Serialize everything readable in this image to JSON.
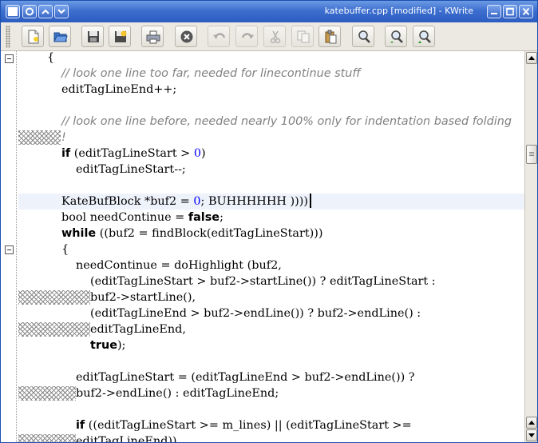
{
  "window": {
    "title": "katebuffer.cpp [modified] - KWrite",
    "minimize_glyph": "–",
    "close_glyph": "✕"
  },
  "toolbar": {
    "buttons": [
      {
        "name": "new-document-button",
        "icon": "new-document-icon"
      },
      {
        "name": "open-button",
        "icon": "folder-open-icon"
      },
      {
        "name": "save-button",
        "icon": "floppy-disk-icon"
      },
      {
        "name": "save-as-button",
        "icon": "save-as-icon"
      },
      {
        "name": "print-button",
        "icon": "printer-icon"
      },
      {
        "name": "close-document-button",
        "icon": "close-circle-icon"
      },
      {
        "name": "undo-button",
        "icon": "undo-icon"
      },
      {
        "name": "redo-button",
        "icon": "redo-icon"
      },
      {
        "name": "cut-button",
        "icon": "scissors-icon"
      },
      {
        "name": "copy-button",
        "icon": "copy-icon"
      },
      {
        "name": "paste-button",
        "icon": "clipboard-icon"
      },
      {
        "name": "find-button",
        "icon": "magnifier-icon"
      },
      {
        "name": "find-next-button",
        "icon": "magnifier-next-icon"
      },
      {
        "name": "find-previous-button",
        "icon": "magnifier-previous-icon"
      }
    ]
  },
  "editor": {
    "lines": [
      {
        "t": "{"
      },
      {
        "t": "// look one line too far, needed for linecontinue stuff"
      },
      {
        "t": "editTagLineEnd++;"
      },
      {
        "t": ""
      },
      {
        "t": "// look one line before, needed nearly 100% only for indentation based folding"
      },
      {
        "t": "!"
      },
      {
        "a": "if",
        "b": " (editTagLineStart > ",
        "c": "0",
        "d": ")"
      },
      {
        "t": "editTagLineStart--;"
      },
      {
        "t": ""
      },
      {
        "a": "KateBufBlock *buf2 = ",
        "b": "0",
        "c": "; BUHHHHHH ))))"
      },
      {
        "a": "bool needContinue = ",
        "b": "false",
        "c": ";"
      },
      {
        "a": "while",
        "b": " ((buf2 = findBlock(editTagLineStart)))"
      },
      {
        "t": "{"
      },
      {
        "t": "needContinue = doHighlight (buf2,"
      },
      {
        "t": "(editTagLineStart > buf2->startLine()) ? editTagLineStart :"
      },
      {
        "t": "buf2->startLine(),"
      },
      {
        "t": "(editTagLineEnd > buf2->endLine()) ? buf2->endLine() :"
      },
      {
        "t": "editTagLineEnd,"
      },
      {
        "a": "true",
        "b": ");"
      },
      {
        "t": ""
      },
      {
        "t": "editTagLineStart = (editTagLineEnd > buf2->endLine()) ?"
      },
      {
        "t": "buf2->endLine() : editTagLineEnd;"
      },
      {
        "t": ""
      },
      {
        "a": "if",
        "b": " ((editTagLineStart >= m_lines) || (editTagLineStart >="
      },
      {
        "t": "editTagLineEnd))"
      }
    ]
  }
}
